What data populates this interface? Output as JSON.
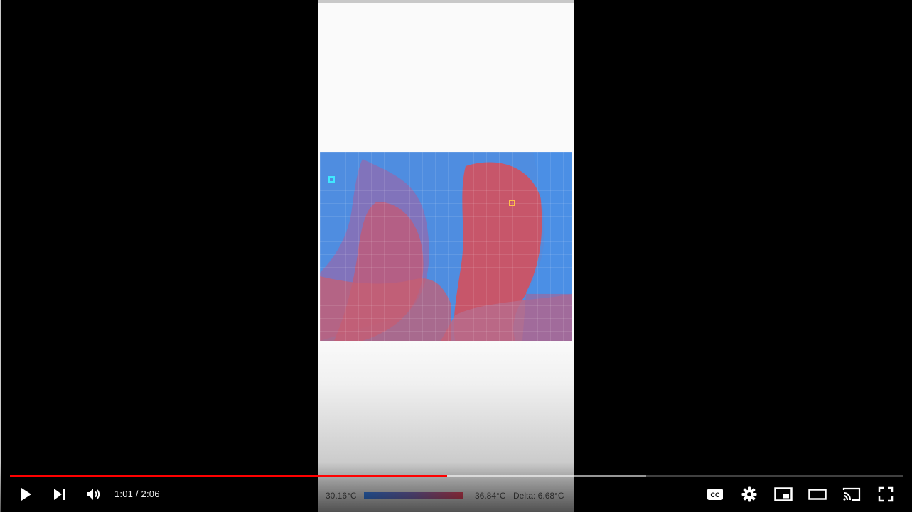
{
  "player": {
    "current_time": "1:01",
    "separator": " / ",
    "duration": "2:06",
    "progress": {
      "played_fraction": 0.4896,
      "buffered_fraction": 0.7126
    },
    "buttons": {
      "play": "play-icon",
      "next": "skip-next-icon",
      "volume": "volume-icon",
      "subtitles": "closed-captions-icon",
      "settings": "gear-icon",
      "miniplayer": "miniplayer-icon",
      "theater": "theater-mode-icon",
      "cast": "cast-icon",
      "fullscreen": "fullscreen-icon"
    },
    "colors": {
      "played": "#ff0000",
      "background": "#000000"
    }
  },
  "video_content": {
    "legend": {
      "min_temp": "30.16°C",
      "max_temp": "36.84°C",
      "delta": "Delta: 6.68°C"
    },
    "colors": {
      "cold": "#4f8de0",
      "hot": "#c7566a",
      "cold_marker": "#40e8ff",
      "hot_marker": "#ffc24a"
    }
  }
}
